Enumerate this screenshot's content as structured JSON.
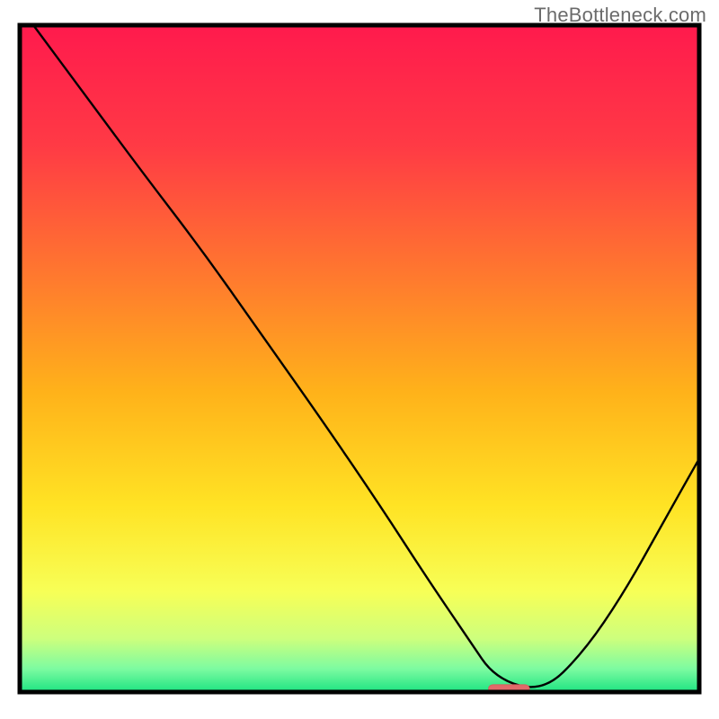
{
  "watermark": "TheBottleneck.com",
  "colors": {
    "border": "#000000",
    "curve": "#000000",
    "marker_fill": "#e06a6a",
    "marker_stroke": "#d85c5c",
    "gradient_stops": [
      {
        "offset": 0.0,
        "color": "#ff1a4d"
      },
      {
        "offset": 0.18,
        "color": "#ff3a45"
      },
      {
        "offset": 0.38,
        "color": "#ff7a2e"
      },
      {
        "offset": 0.55,
        "color": "#ffb21a"
      },
      {
        "offset": 0.72,
        "color": "#ffe324"
      },
      {
        "offset": 0.85,
        "color": "#f7ff57"
      },
      {
        "offset": 0.92,
        "color": "#cdff7d"
      },
      {
        "offset": 0.965,
        "color": "#7dfba1"
      },
      {
        "offset": 1.0,
        "color": "#1de482"
      }
    ]
  },
  "chart_data": {
    "type": "line",
    "title": "",
    "xlabel": "",
    "ylabel": "",
    "xlim": [
      0,
      100
    ],
    "ylim": [
      0,
      100
    ],
    "grid": false,
    "legend": false,
    "marker": {
      "x": 72,
      "y": 0.5,
      "width_pct": 6,
      "height_pct": 1.2
    },
    "x": [
      2,
      10,
      18,
      27,
      36,
      45,
      53,
      60,
      66,
      70,
      77,
      83,
      89,
      95,
      100
    ],
    "values": [
      100,
      89,
      78,
      66,
      53,
      40,
      28,
      17,
      8,
      2,
      0,
      6,
      15,
      26,
      35
    ]
  }
}
